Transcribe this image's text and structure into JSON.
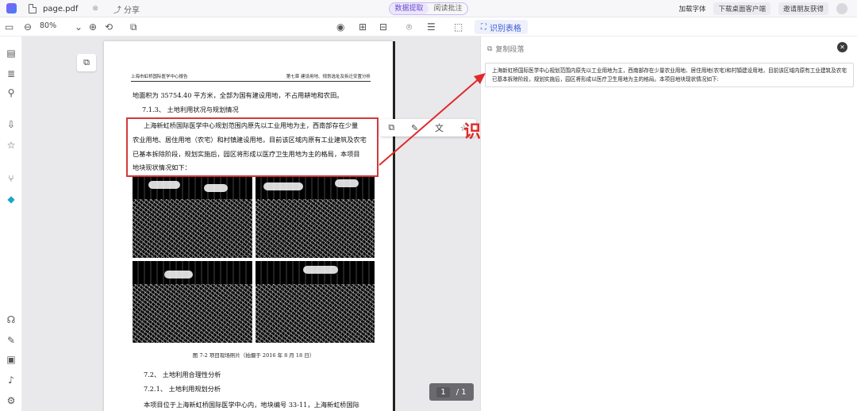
{
  "topbar": {
    "doc_name": "page.pdf",
    "close_glyph": "⊗",
    "share_label": "分享",
    "modes": [
      "数据提取",
      "阅读批注"
    ],
    "active_mode": "数据提取",
    "right_items": [
      "加载字体",
      "下载桌面客户端",
      "邀请朋友获得"
    ]
  },
  "toolbar": {
    "zoom": "80%",
    "ocr_label": "识别表格"
  },
  "page": {
    "header_left": "上海市虹桥国际医学中心报告",
    "header_right": "第七章 建设用地、规划选址及拆迁安置分析",
    "lines": [
      "地面积为 35754.40 平方米，全部为国有建设用地，不占用耕地和农田。",
      "7.1.3、 土地利用状况与规划情况",
      "上海新虹桥国际医学中心规划范围内原先以工业用地为主，西南部存在少量",
      "农业用地、居住用地（农宅）和村镇建设用地，目前该区域内原有工业建筑及农宅",
      "已基本拆除阶段，规划实施后，园区将形成以医疗卫生用地为主的格局，本项目",
      "地块现状情况如下："
    ],
    "caption": "图 7-2 项目现场照片（拍摄于 2016 年 8 月 18 日）",
    "lines_after": [
      "7.2、 土地利用合理性分析",
      "7.2.1、 土地利用规划分析",
      "本项目位于上海新虹桥国际医学中心内，地块编号 33-11，上海新虹桥国际"
    ]
  },
  "annotation_text": "识别完整且准确",
  "pager": {
    "current": "1",
    "total": "/ 1"
  },
  "panel": {
    "title": "复制段落",
    "result_text": "上海新虹桥国际医学中心规划范围内原先以工业用地为主，西南部存在少量农业用地、居住用地(农宅)和村镇建设用地，目前该区域内原有工业建筑及农宅已基本拆除阶段，规划实施后，园区将形成以医疗卫生用地为主的格局。本项目地块现状情况如下:"
  },
  "colors": {
    "accent": "#6a4bd1",
    "highlight": "#d23a3a",
    "annotation": "#e02a2a"
  }
}
